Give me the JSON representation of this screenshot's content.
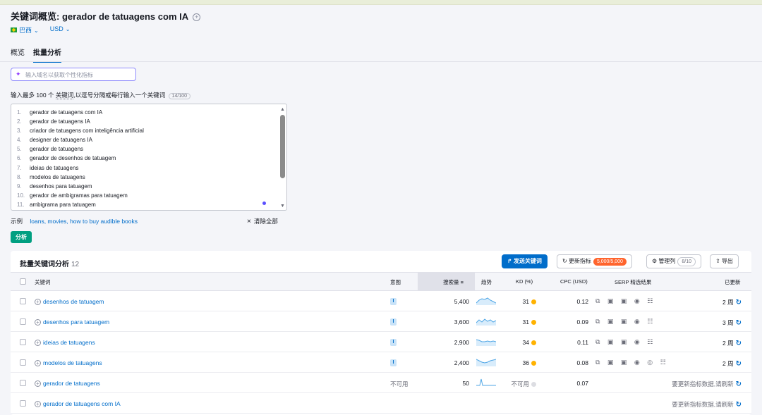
{
  "header": {
    "title_prefix": "关键词概览:",
    "query": "gerador de tatuagens com IA",
    "country": "巴西",
    "currency": "USD"
  },
  "tabs": [
    {
      "label": "概览",
      "active": false
    },
    {
      "label": "批量分析",
      "active": true
    }
  ],
  "domain_input": {
    "placeholder": "输入域名以获取个性化指标"
  },
  "hint": {
    "prefix": "输入最多 100 个",
    "keywords_word": "关键词",
    "suffix": ",以逗号分隔或每行输入一个关键词",
    "count": "14/100"
  },
  "keyword_list": [
    {
      "n": "1.",
      "text": "gerador de tatuagens com IA"
    },
    {
      "n": "2.",
      "text": "gerador de tatuagens IA"
    },
    {
      "n": "3.",
      "text": "criador de tatuagens com inteligência artificial"
    },
    {
      "n": "4.",
      "text": "designer de tatuagens IA"
    },
    {
      "n": "5.",
      "text": "gerador de tatuagens"
    },
    {
      "n": "6.",
      "text": "gerador de desenhos de tatuagem"
    },
    {
      "n": "7.",
      "text": "ideias de tatuagens"
    },
    {
      "n": "8.",
      "text": "modelos de tatuagens"
    },
    {
      "n": "9.",
      "text": "desenhos para tatuagem"
    },
    {
      "n": "10.",
      "text": "gerador de ambigramas para tatuagem"
    },
    {
      "n": "11.",
      "text": "ambigrama para tatuagem"
    }
  ],
  "examples": {
    "label": "示例",
    "link": "loans, movies, how to buy audible books"
  },
  "clear_all": "清除全部",
  "analyze_button": "分析",
  "panel": {
    "title": "批量关键词分析",
    "count": "12",
    "send_button": "发送关键词",
    "update_button": "更新指标",
    "update_quota": "5,000/5,000",
    "manage_button": "管理列",
    "manage_count": "8/10",
    "export_button": "导出"
  },
  "columns": {
    "keyword": "关键词",
    "intent": "意图",
    "volume": "搜索量",
    "trend": "趋势",
    "kd": "KD (%)",
    "cpc": "CPC (USD)",
    "serp": "SERP 精选结果",
    "updated": "已更新"
  },
  "rows": [
    {
      "keyword": "desenhos de tatuagem",
      "intent": "I",
      "volume": "5,400",
      "kd": "31",
      "cpc": "0.12",
      "serp": "⧉ ▣ ▣ ◉ ☷",
      "updated": "2 周"
    },
    {
      "keyword": "desenhos para tatuagem",
      "intent": "I",
      "volume": "3,600",
      "kd": "31",
      "cpc": "0.09",
      "serp": "⧉ ▣ ▣ ◉ ☷",
      "updated": "3 周"
    },
    {
      "keyword": "ideias de tatuagens",
      "intent": "I",
      "volume": "2,900",
      "kd": "34",
      "cpc": "0.11",
      "serp": "⧉ ▣ ▣ ◉ ☷",
      "updated": "2 周"
    },
    {
      "keyword": "modelos de tatuagens",
      "intent": "I",
      "volume": "2,400",
      "kd": "36",
      "cpc": "0.08",
      "serp": "⧉ ▣ ▣ ◉ ◎ ☷",
      "updated": "2 周"
    },
    {
      "keyword": "gerador de tatuagens",
      "intent_na": "不可用",
      "volume": "50",
      "kd_na": "不可用",
      "cpc": "0.07",
      "needs_refresh": "要更新指标数据,请刷新"
    },
    {
      "keyword": "gerador de tatuagens com IA",
      "needs_refresh": "要更新指标数据,请刷新"
    }
  ],
  "colors": {
    "accent": "#006dca",
    "analyze": "#009f81",
    "kd_easy": "#ffb200",
    "quota": "#ff642d"
  },
  "icons": [
    "plus-circle-icon",
    "chevron-down-icon",
    "sparkle-icon",
    "close-icon",
    "send-icon",
    "refresh-icon",
    "gear-icon",
    "export-icon",
    "sort-icon"
  ]
}
